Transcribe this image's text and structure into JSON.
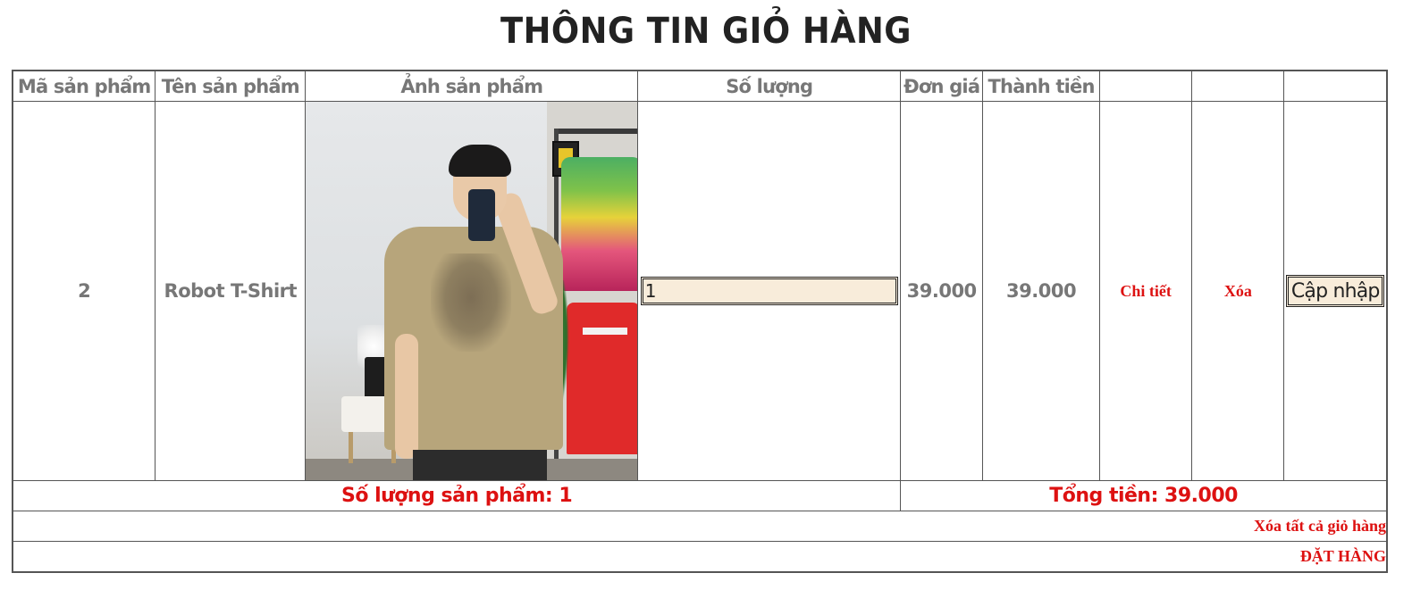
{
  "page": {
    "title": "THÔNG TIN GIỎ HÀNG"
  },
  "table": {
    "headers": [
      "Mã sản phẩm",
      "Tên sản phẩm",
      "Ảnh sản phẩm",
      "Số lượng",
      "Đơn giá",
      "Thành tiền",
      "",
      "",
      ""
    ],
    "rows": [
      {
        "product_id": "2",
        "product_name": "Robot T-Shirt",
        "image_icon": "product-photo",
        "quantity_value": "1",
        "unit_price": "39.000",
        "line_total": "39.000",
        "details_link": "Chi tiết",
        "delete_link": "Xóa",
        "update_button": "Cập nhập"
      }
    ]
  },
  "summary": {
    "item_count": "Số lượng sản phẩm: 1",
    "total": "Tổng tiền: 39.000"
  },
  "actions": {
    "clear_cart": "Xóa tất cả giỏ hàng",
    "place_order": "ĐẶT HÀNG"
  },
  "colors": {
    "accent_red": "#dd1111",
    "header_gray": "#777777",
    "input_bg": "#f8ecda"
  }
}
